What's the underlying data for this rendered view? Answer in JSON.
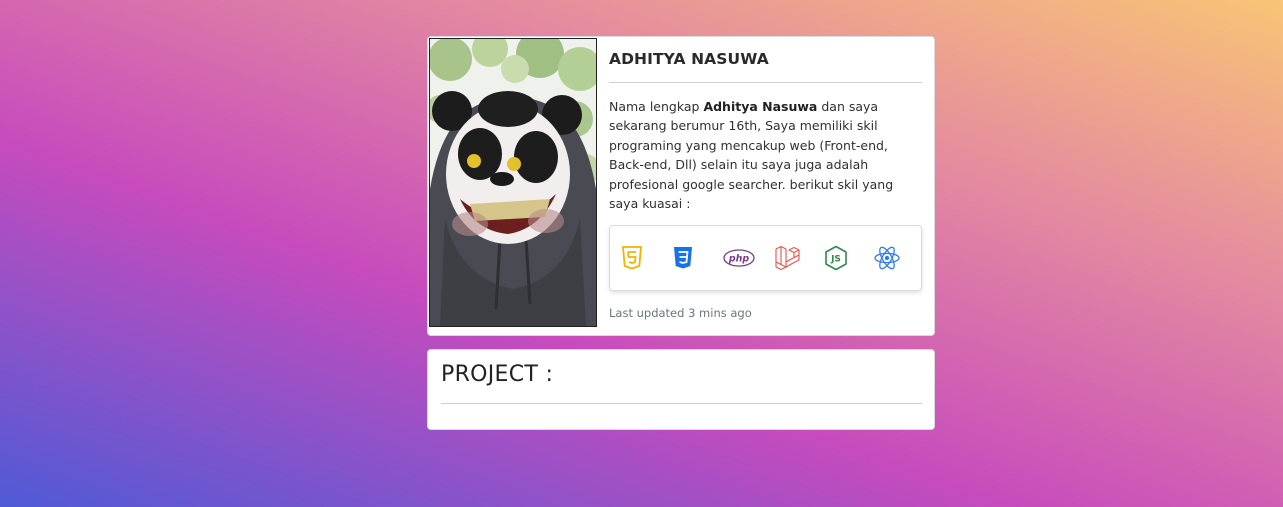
{
  "profile": {
    "name": "ADHITYA NASUWA",
    "bio_prefix": "Nama lengkap ",
    "bio_name": "Adhitya Nasuwa",
    "bio_suffix": " dan saya sekarang berumur 16th, Saya memiliki skil programing yang mencakup web (Front-end, Back-end, Dll) selain itu saya juga adalah profesional google searcher. berikut skil yang saya kuasai :",
    "photo_alt": "panda mask profile photo",
    "last_updated": "Last updated 3 mins ago"
  },
  "skills": [
    {
      "name": "html5-icon",
      "color": "#f0b400"
    },
    {
      "name": "css3-icon",
      "color": "#1572e8"
    },
    {
      "name": "php-icon",
      "color": "#7a3b8c",
      "label": "php"
    },
    {
      "name": "laravel-icon",
      "color": "#e5534b"
    },
    {
      "name": "nodejs-icon",
      "color": "#2f8a4c",
      "label": "JS"
    },
    {
      "name": "react-icon",
      "color": "#2e7cf6"
    }
  ],
  "project": {
    "title": "PROJECT :"
  },
  "colors": {
    "card_bg": "#ffffff",
    "muted_text": "#6c757d"
  }
}
